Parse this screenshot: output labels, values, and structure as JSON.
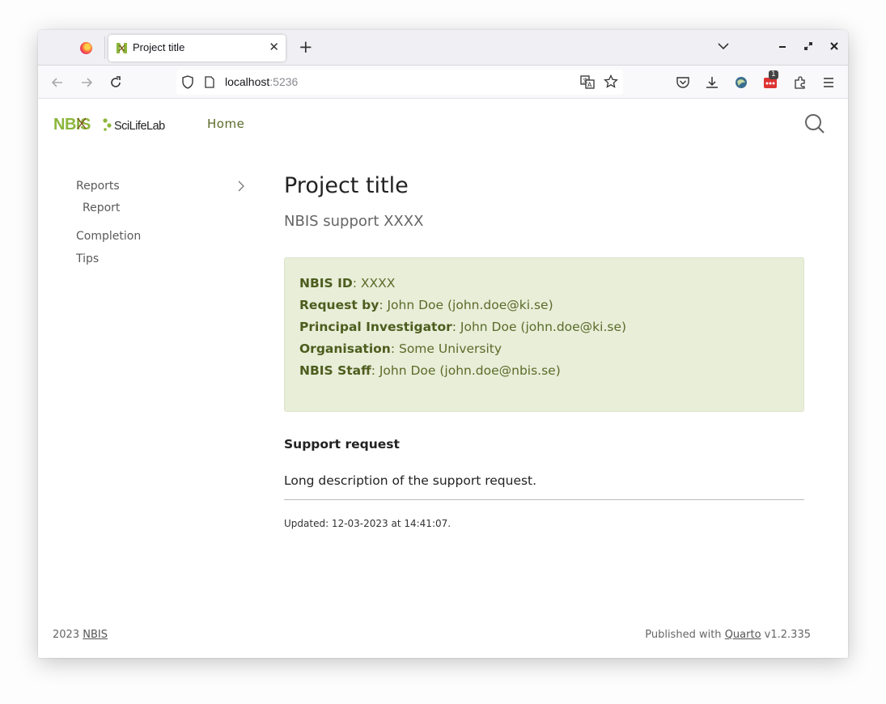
{
  "browser": {
    "tab_title": "Project title",
    "new_tab_symbol": "+",
    "tab_close_symbol": "✕",
    "url_host": "localhost",
    "url_port": ":5236",
    "extension_badge": "1",
    "icons": [
      "back-icon",
      "forward-icon",
      "reload-icon",
      "shield-icon",
      "page-icon",
      "translate-icon",
      "star-icon",
      "pocket-icon",
      "download-icon",
      "extension-icon",
      "puzzle-icon",
      "menu-icon",
      "minimize-icon",
      "maximize-icon",
      "close-icon",
      "tab-list-icon"
    ]
  },
  "site": {
    "brand_left": "NBIS",
    "brand_right": "SciLifeLab",
    "nav_home": "Home"
  },
  "sidebar": {
    "items": [
      {
        "label": "Reports"
      },
      {
        "label": "Report"
      },
      {
        "label": "Completion"
      },
      {
        "label": "Tips"
      }
    ]
  },
  "main": {
    "title": "Project title",
    "subtitle": "NBIS support XXXX",
    "callout": [
      {
        "key": "NBIS ID",
        "value": ": XXXX"
      },
      {
        "key": "Request by",
        "value": ": John Doe (john.doe@ki.se)"
      },
      {
        "key": "Principal Investigator",
        "value": ": John Doe (john.doe@ki.se)"
      },
      {
        "key": "Organisation",
        "value": ": Some University"
      },
      {
        "key": "NBIS Staff",
        "value": ": John Doe (john.doe@nbis.se)"
      }
    ],
    "support_heading": "Support request",
    "description": "Long description of the support request.",
    "updated": "Updated: 12-03-2023 at 14:41:07."
  },
  "footer": {
    "year": "2023",
    "org_link": "NBIS",
    "published_prefix": "Published with",
    "quarto_link": "Quarto",
    "version": "v1.2.335"
  },
  "colors": {
    "accent_green": "#5a6b2a",
    "callout_bg": "#e8eed8",
    "nbis_green": "#8cb63c"
  }
}
